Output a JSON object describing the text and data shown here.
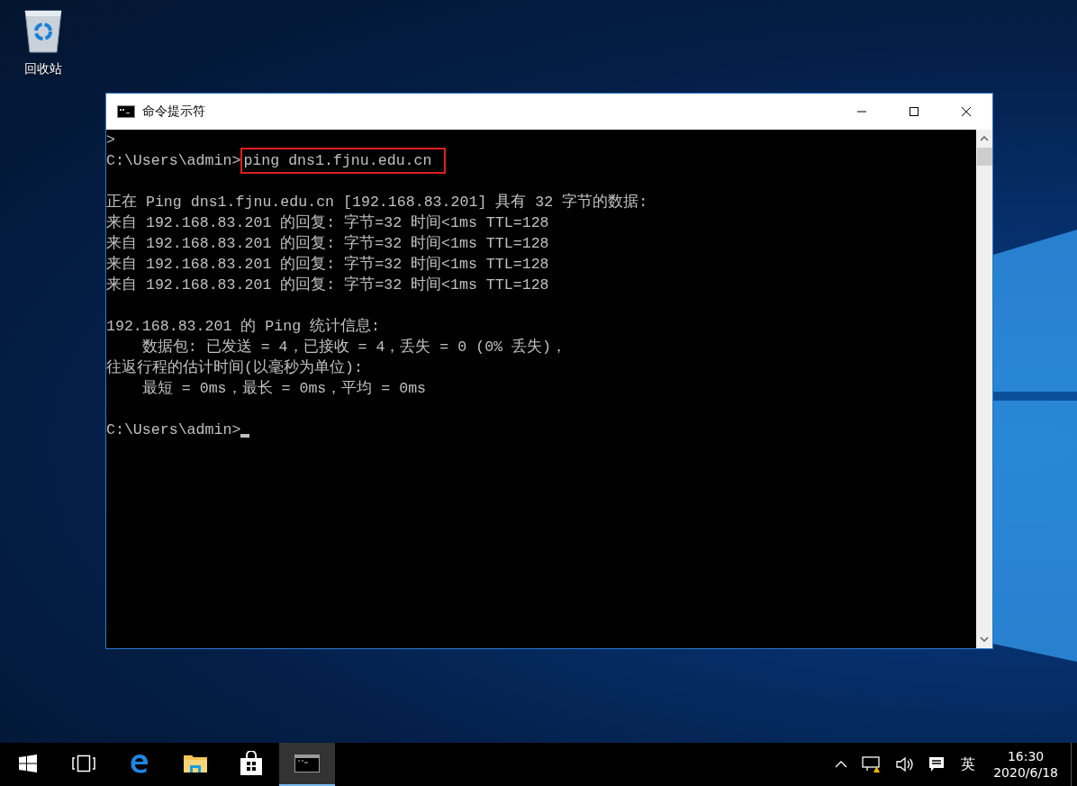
{
  "desktop_icons": [
    {
      "label": "回收站"
    }
  ],
  "window": {
    "title": "命令提示符",
    "console_lines": [
      {
        "kind": "output",
        "text": ">"
      },
      {
        "kind": "prompt",
        "prompt": "C:\\Users\\admin>",
        "command": "ping dns1.fjnu.edu.cn",
        "highlighted": true,
        "cursor": false
      },
      {
        "kind": "blank"
      },
      {
        "kind": "output",
        "text": "正在 Ping dns1.fjnu.edu.cn [192.168.83.201] 具有 32 字节的数据:"
      },
      {
        "kind": "output",
        "text": "来自 192.168.83.201 的回复: 字节=32 时间<1ms TTL=128"
      },
      {
        "kind": "output",
        "text": "来自 192.168.83.201 的回复: 字节=32 时间<1ms TTL=128"
      },
      {
        "kind": "output",
        "text": "来自 192.168.83.201 的回复: 字节=32 时间<1ms TTL=128"
      },
      {
        "kind": "output",
        "text": "来自 192.168.83.201 的回复: 字节=32 时间<1ms TTL=128"
      },
      {
        "kind": "blank"
      },
      {
        "kind": "output",
        "text": "192.168.83.201 的 Ping 统计信息:"
      },
      {
        "kind": "output",
        "text": "    数据包: 已发送 = 4，已接收 = 4，丢失 = 0 (0% 丢失)，"
      },
      {
        "kind": "output",
        "text": "往返行程的估计时间(以毫秒为单位):"
      },
      {
        "kind": "output",
        "text": "    最短 = 0ms，最长 = 0ms，平均 = 0ms"
      },
      {
        "kind": "blank"
      },
      {
        "kind": "prompt",
        "prompt": "C:\\Users\\admin>",
        "highlighted": false,
        "cursor": true
      }
    ]
  },
  "taskbar": {
    "apps": [
      {
        "kind": "start",
        "selected": false
      },
      {
        "kind": "taskview",
        "selected": false
      },
      {
        "kind": "browser",
        "selected": false
      },
      {
        "kind": "explorer",
        "selected": false
      },
      {
        "kind": "store",
        "selected": false
      },
      {
        "kind": "console",
        "selected": true
      }
    ],
    "tray": {
      "ime": "英",
      "time": "16:30",
      "date": "2020/6/18"
    }
  }
}
